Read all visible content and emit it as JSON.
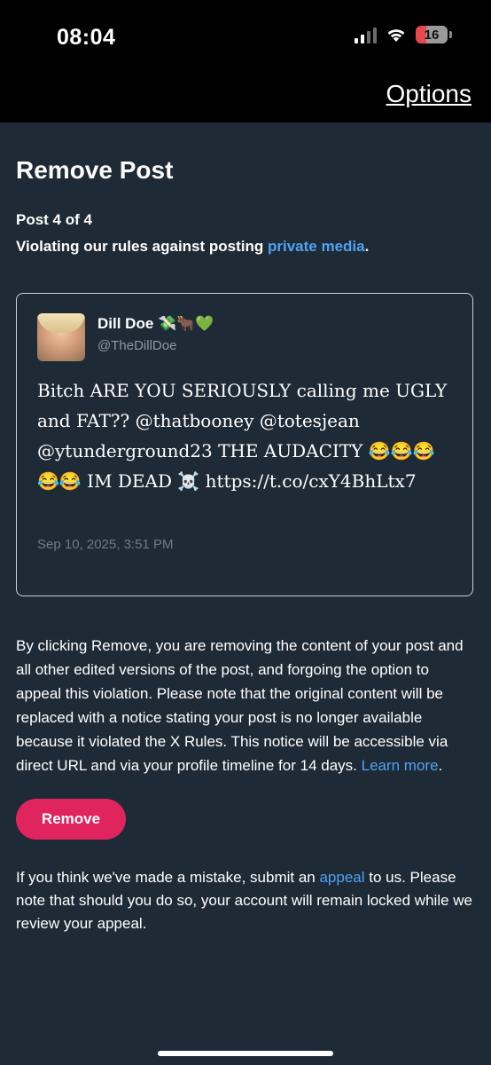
{
  "status_bar": {
    "time": "08:04",
    "battery": "16"
  },
  "header": {
    "options_label": "Options"
  },
  "page": {
    "title": "Remove Post",
    "post_count": "Post 4 of 4",
    "violation_prefix": "Violating our rules against posting ",
    "violation_link": "private media",
    "violation_suffix": "."
  },
  "tweet": {
    "author_name": "Dill Doe",
    "author_emoji": "💸🐂💚",
    "author_handle": "@TheDillDoe",
    "text": "Bitch ARE YOU SERIOUSLY calling me UGLY and FAT?? @thatbooney @totesjean @ytunderground23 THE AUDACITY 😂😂😂😂😂 IM DEAD ☠️ https://t.co/cxY4BhLtx7",
    "date": "Sep 10, 2025, 3:51 PM"
  },
  "notice": {
    "text": "By clicking Remove, you are removing the content of your post and all other edited versions of the post, and forgoing the option to appeal this violation. Please note that the original content will be replaced with a notice stating your post is no longer available because it violated the X Rules. This notice will be accessible via direct URL and via your profile timeline for 14 days. ",
    "learn_more": "Learn more",
    "suffix": "."
  },
  "remove_label": "Remove",
  "appeal": {
    "prefix": "If you think we've made a mistake, submit an ",
    "link": "appeal",
    "suffix": " to us. Please note that should you do so, your account will remain locked while we review your appeal."
  },
  "colors": {
    "accent_link": "#4ea3f1",
    "remove_button": "#e0245e",
    "background": "#1f2a37"
  }
}
